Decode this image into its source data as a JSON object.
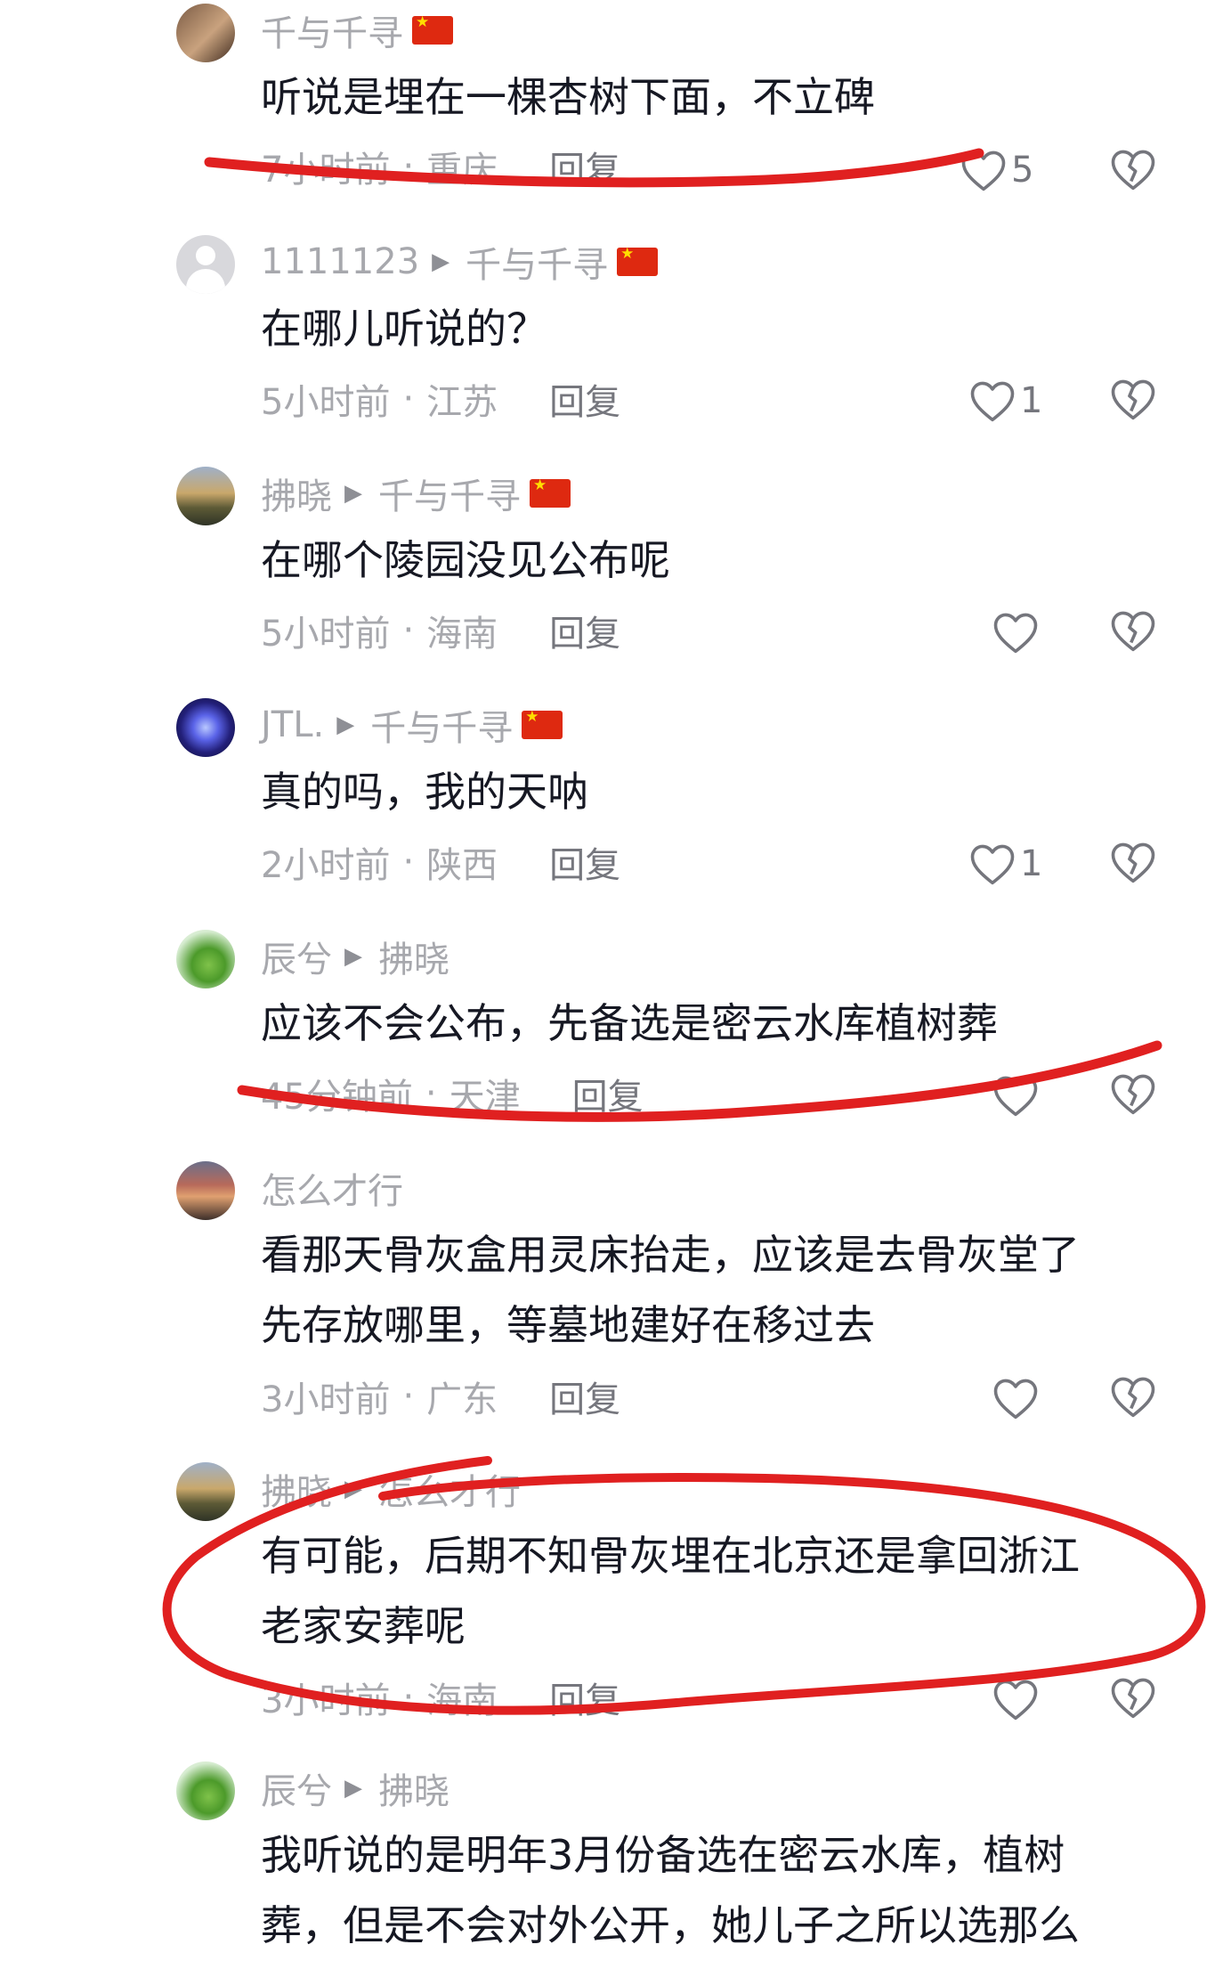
{
  "comments": [
    {
      "user": "千与千寻",
      "reply_to": "",
      "flag": true,
      "text": [
        "听说是埋在一棵杏树下面，不立碑"
      ],
      "time": "7小时前",
      "location": "重庆",
      "reply": "回复",
      "likes": "5"
    },
    {
      "user": "1111123",
      "reply_to": "千与千寻",
      "flag": true,
      "text": [
        "在哪儿听说的？"
      ],
      "time": "5小时前",
      "location": "江苏",
      "reply": "回复",
      "likes": "1"
    },
    {
      "user": "拂晓",
      "reply_to": "千与千寻",
      "flag": true,
      "text": [
        "在哪个陵园没见公布呢"
      ],
      "time": "5小时前",
      "location": "海南",
      "reply": "回复",
      "likes": ""
    },
    {
      "user": "JTL.",
      "reply_to": "千与千寻",
      "flag": true,
      "text": [
        "真的吗，我的天呐"
      ],
      "time": "2小时前",
      "location": "陕西",
      "reply": "回复",
      "likes": "1"
    },
    {
      "user": "辰兮",
      "reply_to": "拂晓",
      "flag": false,
      "text": [
        "应该不会公布，先备选是密云水库植树葬"
      ],
      "time": "45分钟前",
      "location": "天津",
      "reply": "回复",
      "likes": ""
    },
    {
      "user": "怎么才行",
      "reply_to": "",
      "flag": false,
      "text": [
        "看那天骨灰盒用灵床抬走，应该是去骨灰堂了",
        "先存放哪里，等墓地建好在移过去"
      ],
      "time": "3小时前",
      "location": "广东",
      "reply": "回复",
      "likes": ""
    },
    {
      "user": "拂晓",
      "reply_to": "怎么才行",
      "flag": false,
      "text": [
        "有可能，后期不知骨灰埋在北京还是拿回浙江",
        "老家安葬呢"
      ],
      "time": "3小时前",
      "location": "海南",
      "reply": "回复",
      "likes": ""
    },
    {
      "user": "辰兮",
      "reply_to": "拂晓",
      "flag": false,
      "text": [
        "我听说的是明年3月份备选在密云水库，植树",
        "葬，但是不会对外公开，她儿子之所以选那么"
      ],
      "time": "",
      "location": "",
      "reply": "",
      "likes": ""
    }
  ],
  "colors": {
    "annotation": "#e02020",
    "muted": "#a7a8ad",
    "text": "#161823"
  },
  "icons": {
    "like": "heart-outline-icon",
    "dislike": "broken-heart-icon"
  }
}
